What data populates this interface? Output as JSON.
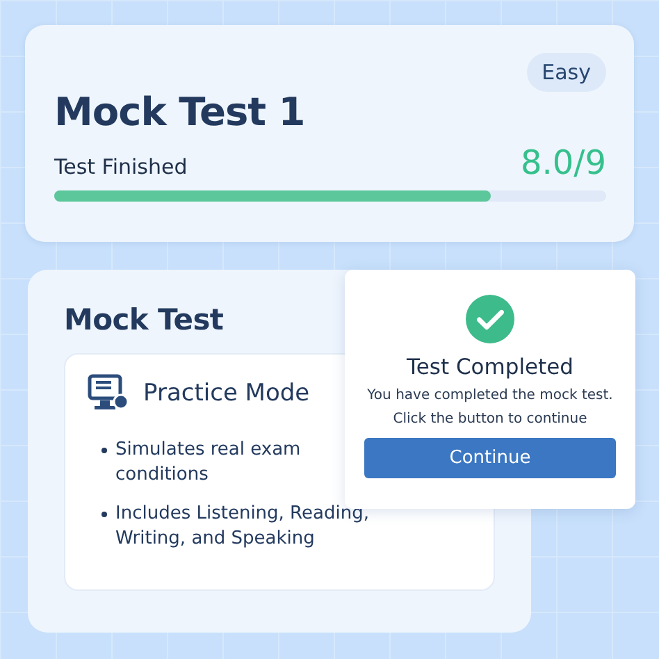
{
  "result_card": {
    "badge": "Easy",
    "title": "Mock Test 1",
    "status": "Test Finished",
    "score": "8.0/9",
    "progress": {
      "level": 0.79
    }
  },
  "mode_card": {
    "title": "Mock Test",
    "mode": {
      "title": "Practice Mode",
      "bullets": [
        "Simulates real exam conditions",
        "Includes Listening, Reading, Writing, and Speaking"
      ]
    }
  },
  "dialog": {
    "title": "Test Completed",
    "message": "You have completed the mock test.",
    "hint": "Click the button to continue",
    "button": "Continue"
  }
}
